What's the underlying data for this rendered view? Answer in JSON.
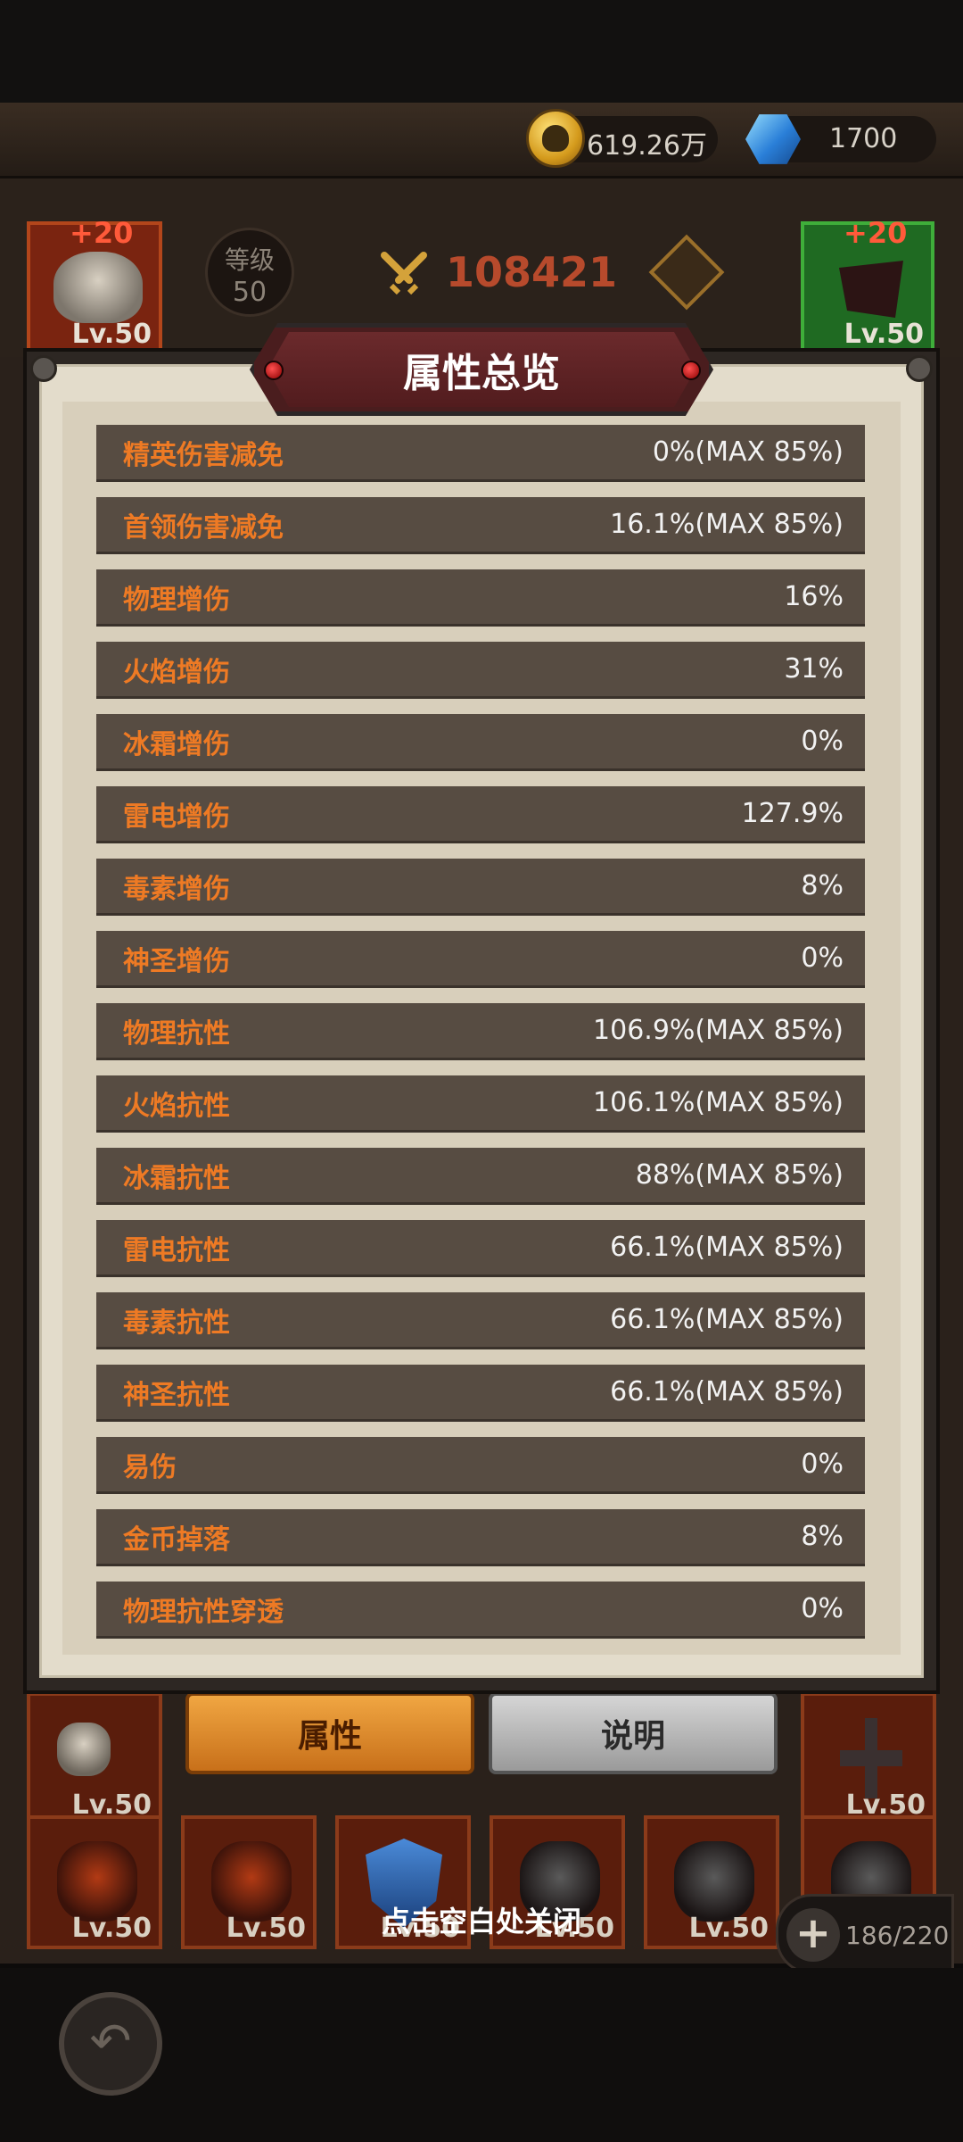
{
  "currency": {
    "coins": "619.26万",
    "gems": "1700"
  },
  "hero": {
    "left_slot": {
      "plus": "+20",
      "level": "Lv.50"
    },
    "right_slot": {
      "plus": "+20",
      "level": "Lv.50"
    },
    "rank_label": "等级",
    "rank_value": "50",
    "power": "108421"
  },
  "modal": {
    "title": "属性总览",
    "rows": [
      {
        "label": "精英伤害减免",
        "value": "0%(MAX 85%)"
      },
      {
        "label": "首领伤害减免",
        "value": "16.1%(MAX 85%)"
      },
      {
        "label": "物理增伤",
        "value": "16%"
      },
      {
        "label": "火焰增伤",
        "value": "31%"
      },
      {
        "label": "冰霜增伤",
        "value": "0%"
      },
      {
        "label": "雷电增伤",
        "value": "127.9%"
      },
      {
        "label": "毒素增伤",
        "value": "8%"
      },
      {
        "label": "神圣增伤",
        "value": "0%"
      },
      {
        "label": "物理抗性",
        "value": "106.9%(MAX 85%)"
      },
      {
        "label": "火焰抗性",
        "value": "106.1%(MAX 85%)"
      },
      {
        "label": "冰霜抗性",
        "value": "88%(MAX 85%)"
      },
      {
        "label": "雷电抗性",
        "value": "66.1%(MAX 85%)"
      },
      {
        "label": "毒素抗性",
        "value": "66.1%(MAX 85%)"
      },
      {
        "label": "神圣抗性",
        "value": "66.1%(MAX 85%)"
      },
      {
        "label": "易伤",
        "value": "0%"
      },
      {
        "label": "金币掉落",
        "value": "8%"
      },
      {
        "label": "物理抗性穿透",
        "value": "0%"
      }
    ]
  },
  "tabs": {
    "attributes": "属性",
    "description": "说明"
  },
  "inventory": {
    "level": "Lv.50",
    "capacity": "186/220"
  },
  "close_hint": "点击空白处关闭"
}
